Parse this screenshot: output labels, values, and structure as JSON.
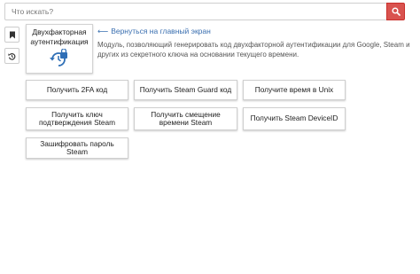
{
  "search": {
    "placeholder": "Что искать?",
    "value": "",
    "button_icon": "search-icon"
  },
  "sidebar": {
    "buttons": [
      {
        "icon": "bookmark-icon"
      },
      {
        "icon": "history-icon"
      }
    ]
  },
  "module": {
    "title": "Двухфакторная аутентификация",
    "icon": "2fa-lock-icon",
    "icon_color": "#2f6fb6"
  },
  "back_link": {
    "label": "Вернуться на главный экран",
    "icon": "arrow-left-icon",
    "color": "#3a6fb0"
  },
  "description": "Модуль, позволяющий генерировать код двухфакторной аутентификации для Google, Steam и других из секретного ключа на основании текущего времени.",
  "actions": [
    {
      "label": "Получить 2FA код"
    },
    {
      "label": "Получить Steam Guard код"
    },
    {
      "label": "Получите время в Unix"
    },
    {
      "label": "Получить ключ подтверждения Steam"
    },
    {
      "label": "Получить смещение времени Steam"
    },
    {
      "label": "Получить Steam DeviceID"
    },
    {
      "label": "Зашифровать пароль Steam"
    }
  ],
  "colors": {
    "search_button": "#d9534f",
    "link": "#3a6fb0"
  }
}
